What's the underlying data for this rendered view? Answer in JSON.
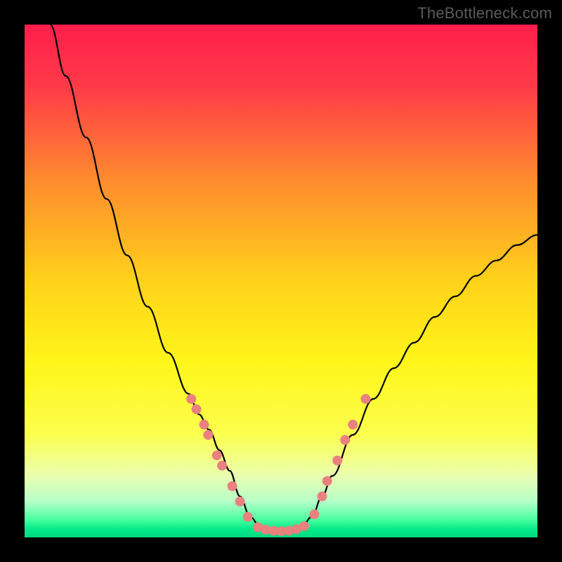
{
  "watermark": "TheBottleneck.com",
  "chart_data": {
    "type": "line",
    "title": "",
    "xlabel": "",
    "ylabel": "",
    "xlim": [
      0,
      100
    ],
    "ylim": [
      0,
      100
    ],
    "grid": false,
    "curve": {
      "name": "bottleneck-curve",
      "color": "#000000",
      "x": [
        5,
        8,
        12,
        16,
        20,
        24,
        28,
        32,
        34,
        36,
        38,
        40,
        42,
        44,
        46,
        48,
        50,
        52,
        54,
        56,
        58,
        60,
        64,
        68,
        72,
        76,
        80,
        84,
        88,
        92,
        96,
        100
      ],
      "y": [
        100,
        90,
        78,
        66,
        55,
        45,
        36,
        28,
        24,
        21,
        17,
        13,
        8,
        4,
        2,
        1,
        1,
        1,
        2,
        4,
        8,
        12,
        20,
        27,
        33,
        38,
        43,
        47,
        51,
        54,
        57,
        59
      ]
    },
    "markers": {
      "name": "dot-markers",
      "color": "#e9817f",
      "radius": 7,
      "points": [
        {
          "x": 32.5,
          "y": 27
        },
        {
          "x": 33.5,
          "y": 25
        },
        {
          "x": 35.0,
          "y": 22
        },
        {
          "x": 35.8,
          "y": 20
        },
        {
          "x": 37.5,
          "y": 16
        },
        {
          "x": 38.5,
          "y": 14
        },
        {
          "x": 40.5,
          "y": 10
        },
        {
          "x": 42.0,
          "y": 7
        },
        {
          "x": 43.5,
          "y": 4
        },
        {
          "x": 45.5,
          "y": 2.0
        },
        {
          "x": 47.0,
          "y": 1.5
        },
        {
          "x": 48.5,
          "y": 1.3
        },
        {
          "x": 50.0,
          "y": 1.2
        },
        {
          "x": 51.5,
          "y": 1.3
        },
        {
          "x": 53.0,
          "y": 1.6
        },
        {
          "x": 54.5,
          "y": 2.2
        },
        {
          "x": 56.5,
          "y": 4.5
        },
        {
          "x": 58.0,
          "y": 8
        },
        {
          "x": 59.0,
          "y": 11
        },
        {
          "x": 61.0,
          "y": 15
        },
        {
          "x": 62.5,
          "y": 19
        },
        {
          "x": 64.0,
          "y": 22
        },
        {
          "x": 66.5,
          "y": 27
        }
      ]
    },
    "background_gradient": {
      "stops": [
        {
          "offset": 0.0,
          "color": "#ff1f4b"
        },
        {
          "offset": 0.12,
          "color": "#ff3a48"
        },
        {
          "offset": 0.3,
          "color": "#ff8a2e"
        },
        {
          "offset": 0.5,
          "color": "#ffd21a"
        },
        {
          "offset": 0.66,
          "color": "#fff619"
        },
        {
          "offset": 0.8,
          "color": "#fbff4e"
        },
        {
          "offset": 0.88,
          "color": "#eaffb0"
        },
        {
          "offset": 0.93,
          "color": "#b6ffc9"
        },
        {
          "offset": 0.965,
          "color": "#4aff9e"
        },
        {
          "offset": 0.985,
          "color": "#00e889"
        },
        {
          "offset": 1.0,
          "color": "#00d87f"
        }
      ]
    }
  }
}
